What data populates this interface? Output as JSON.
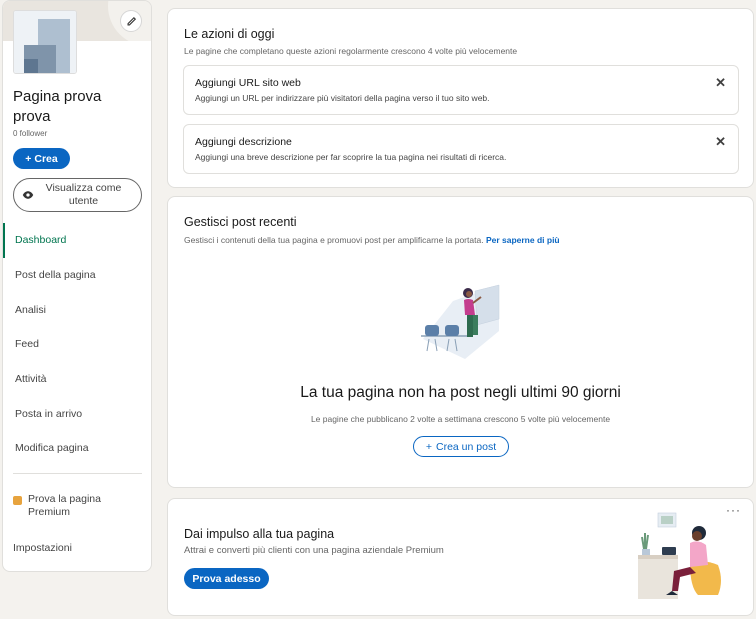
{
  "sidebar": {
    "page_name": "Pagina prova prova",
    "followers": "0 follower",
    "create_label": "Crea",
    "view_as_user_label": "Visualizza come utente",
    "nav": [
      {
        "label": "Dashboard",
        "active": true
      },
      {
        "label": "Post della pagina"
      },
      {
        "label": "Analisi"
      },
      {
        "label": "Feed"
      },
      {
        "label": "Attività"
      },
      {
        "label": "Posta in arrivo"
      },
      {
        "label": "Modifica pagina"
      }
    ],
    "premium_label": "Prova la pagina Premium",
    "settings_label": "Impostazioni"
  },
  "today_actions": {
    "title": "Le azioni di oggi",
    "subtitle": "Le pagine che completano queste azioni regolarmente crescono 4 volte più velocemente",
    "items": [
      {
        "title": "Aggiungi URL sito web",
        "description": "Aggiungi un URL per indirizzare più visitatori della pagina verso il tuo sito web."
      },
      {
        "title": "Aggiungi descrizione",
        "description": "Aggiungi una breve descrizione per far scoprire la tua pagina nei risultati di ricerca."
      }
    ]
  },
  "recent_posts": {
    "title": "Gestisci post recenti",
    "subtitle": "Gestisci i contenuti della tua pagina e promuovi post per amplificarne la portata.",
    "learn_more": "Per saperne di più",
    "empty_title": "La tua pagina non ha post negli ultimi 90 giorni",
    "empty_subtitle": "Le pagine che pubblicano 2 volte a settimana crescono 5 volte più velocemente",
    "create_post_label": "Crea un post"
  },
  "boost": {
    "title": "Dai impulso alla tua pagina",
    "subtitle": "Attrai e converti più clienti con una pagina aziendale Premium",
    "try_label": "Prova adesso",
    "more_label": "···"
  },
  "colors": {
    "accent": "#0a66c2",
    "active_nav": "#01754f",
    "premium": "#e7a33e"
  }
}
